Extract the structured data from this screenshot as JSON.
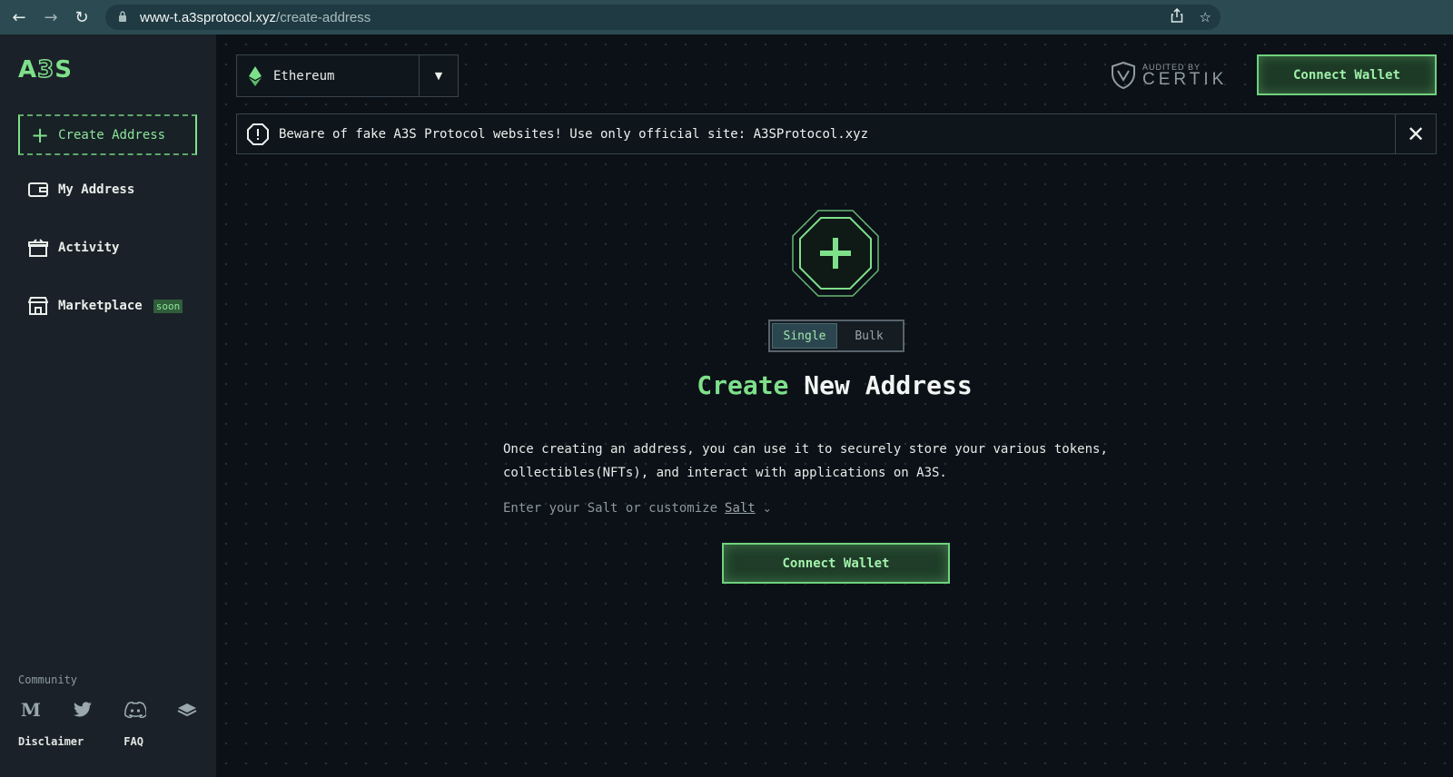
{
  "browser": {
    "url_host": "www-t.a3sprotocol.xyz",
    "url_path": "/create-address"
  },
  "sidebar": {
    "logo_main": "A",
    "logo_outline": "3",
    "logo_end": "S",
    "create_label": "Create Address",
    "items": [
      {
        "label": "My Address",
        "icon": "wallet-icon"
      },
      {
        "label": "Activity",
        "icon": "gift-icon"
      },
      {
        "label": "Marketplace",
        "icon": "store-icon",
        "badge": "soon"
      }
    ],
    "community_label": "Community",
    "socials": [
      "medium-icon",
      "twitter-icon",
      "discord-icon",
      "gitbook-icon"
    ],
    "medium_glyph": "M",
    "footer": {
      "disclaimer": "Disclaimer",
      "faq": "FAQ"
    }
  },
  "header": {
    "network": "Ethereum",
    "audited_by": "AUDITED BY",
    "auditor": "CERTIK",
    "connect_wallet": "Connect Wallet"
  },
  "warning": {
    "message": "Beware of fake A3S Protocol websites! Use only official site: A3SProtocol.xyz"
  },
  "main": {
    "tabs": {
      "single": "Single",
      "bulk": "Bulk",
      "selected": "Single"
    },
    "title_accent": "Create",
    "title_rest": " New Address",
    "description": "Once creating an address, you can use it to securely store your various tokens, collectibles(NFTs), and interact with applications on A3S.",
    "salt_prompt": "Enter your Salt or customize",
    "salt_link": "Salt",
    "connect_wallet": "Connect Wallet"
  },
  "colors": {
    "accent": "#7ee08a",
    "background": "#0b1117",
    "sidebar": "#1a2128"
  }
}
